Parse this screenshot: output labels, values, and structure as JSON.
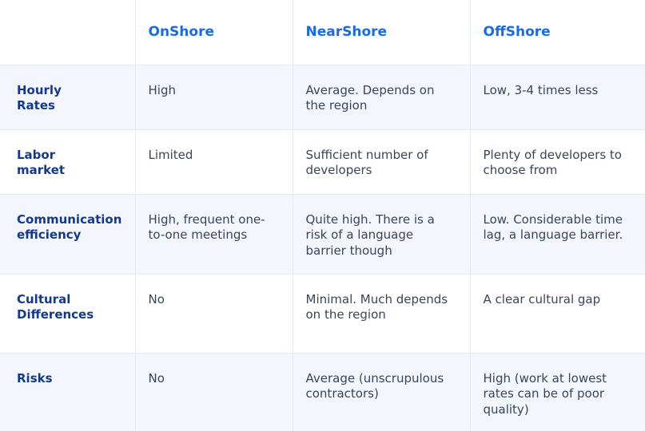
{
  "table": {
    "columns": [
      "",
      "OnShore",
      "NearShore",
      "OffShore"
    ],
    "rows": [
      {
        "label": "Hourly Rates",
        "label_lines": [
          "Hourly",
          "Rates"
        ],
        "cells": [
          "High",
          "Average. Depends on the region",
          "Low, 3-4 times less"
        ],
        "shaded": true
      },
      {
        "label": "Labor market",
        "label_lines": [
          "Labor",
          "market"
        ],
        "cells": [
          "Limited",
          "Sufficient number of developers",
          "Plenty of developers to choose from"
        ],
        "shaded": false
      },
      {
        "label": "Communication efficiency",
        "label_lines": [
          "Communication",
          "efficiency"
        ],
        "cells": [
          "High, frequent one-to-one meetings",
          "Quite high. There is a risk of a language barrier though",
          "Low. Considerable time lag, a language barrier."
        ],
        "shaded": true
      },
      {
        "label": "Cultural Differences",
        "label_lines": [
          "Cultural",
          "Differences"
        ],
        "cells": [
          "No",
          "Minimal. Much depends on the region",
          "A clear cultural gap"
        ],
        "shaded": false
      },
      {
        "label": "Risks",
        "label_lines": [
          "Risks"
        ],
        "cells": [
          "No",
          "Average (unscrupulous contractors)",
          "High (work at lowest rates can be of poor quality)"
        ],
        "shaded": true
      }
    ]
  },
  "colors": {
    "header_text": "#1a6ae8",
    "row_label_text": "#15398a",
    "cell_text": "#3a4558",
    "shaded_row_bg": "#f3f7fd",
    "grid_line": "#e4ebf5"
  }
}
